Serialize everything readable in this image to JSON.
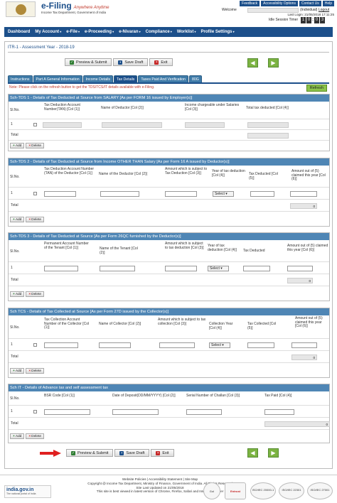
{
  "header": {
    "brand": "e-Filing",
    "tagline": "Anywhere Anytime",
    "subtitle": "Income Tax Department, Government of India",
    "links": [
      "Feedback",
      "Accessibility Options",
      "Contact Us",
      "Help"
    ],
    "welcome_label": "Welcome",
    "user_type": "(Individual)",
    "logout": "Logout",
    "last_login": "Last Login: 21/05/2018 17:11:25",
    "idle_label": "Idle Session Timer",
    "timer_digits": [
      "1",
      "0",
      "0",
      "3"
    ]
  },
  "nav": [
    "Dashboard",
    "My Account",
    "e-File",
    "e-Proceeding",
    "e-Nivaran",
    "Compliance",
    "Worklist",
    "Profile Settings"
  ],
  "form_title": "ITR-1 - Assessment Year - 2018-19",
  "actions": {
    "preview": "Preview & Submit",
    "save": "Save Draft",
    "exit": "Exit"
  },
  "tabs": [
    "Instructions",
    "Part A General Information",
    "Income Details",
    "Tax Details",
    "Taxes Paid And Verification",
    "80G"
  ],
  "note": "Note: Please click on the refresh button to get the TDS/TCS/IT details available with e-Filing.",
  "refresh": "Refresh",
  "common": {
    "slno": "Sl.No.",
    "total": "Total",
    "add": "Add",
    "delete": "Delete",
    "select": "Select",
    "zero": "0",
    "one": "1"
  },
  "s1": {
    "title": "Sch-TDS 1 - Details of Tax Deducted at Source from SALARY [As per FORM 16 issued by Employer(s)]",
    "cols": [
      "Tax Deduction Account Number(TAN) [Col (1)]",
      "Name of Deductor [Col (2)]",
      "Income chargeable under Salaries [Col (3)]",
      "Total tax deducted [Col (4)]"
    ]
  },
  "s2": {
    "title": "Sch-TDS 2 - Details of Tax Deducted at Source from Income OTHER THAN Salary [As per Form 16 A issued by Deductor(s)]",
    "cols": [
      "Tax Deduction Account Number (TAN) of the Deductor [Col (1)]",
      "Name of the Deductor [Col (2)]",
      "Amount which is subject to Tax Deduction [Col (3)]",
      "Year of tax deduction [Col (4)]",
      "Tax Deducted [Col (5)]",
      "Amount out of (5) claimed this year [Col (6)]"
    ]
  },
  "s3": {
    "title": "Sch-TDS 3 - Details of Tax Deducted at Source [As per Form 26QC furnished by the Deductor(s)]",
    "cols": [
      "Permanent Account Number of the Tenant [Col (1)]",
      "Name of the Tenant [Col (2)]",
      "Amount which is subject to tax deduction [Col (3)]",
      "Year of tax deduction [Col (4)]",
      "Tax Deducted",
      "Amount out of (5) claimed this year [Col (6)]"
    ]
  },
  "s4": {
    "title": "Sch TCS - Details of Tax Collected at Source [As per Form 27D issued by the Collector(s)]",
    "cols": [
      "Tax Collection Account Number of the Collector [Col (1)]",
      "Name of Collector [Col (2)]",
      "Amount which is subject to tax collection [Col (3)]",
      "Collection Year [Col (4)]",
      "Tax Collected [Col (5)]",
      "Amount out of (5) claimed this year [Col (6)]"
    ]
  },
  "s5": {
    "title": "Sch IT - Details of Advance tax and self assessment tax",
    "cols": [
      "BSR Code [Col (1)]",
      "Date of Deposit(DD/MM/YYYY) [Col (2)]",
      "Serial Number of Challan [Col (3)]",
      "Tax Paid [Col (4)]"
    ]
  },
  "footer": {
    "lines": [
      "Website Policies | Accessibility Statement | Site Map",
      "Copyright @ Income Tax Department, Ministry of Finance, Government of India. All Rights Reserved",
      "Site Last Updated on 21/05/2018",
      "This site is best viewed in latest version of Chrome, Firefox, Safari and Internet Explorer"
    ],
    "indiagov": "india.gov.in",
    "indiagov_sub": "The national portal of India",
    "badges": [
      "GoI",
      "Entrust",
      "ISO/IEC 20000-1",
      "ISO/IEC 22301",
      "ISO/IEC 27001"
    ]
  }
}
